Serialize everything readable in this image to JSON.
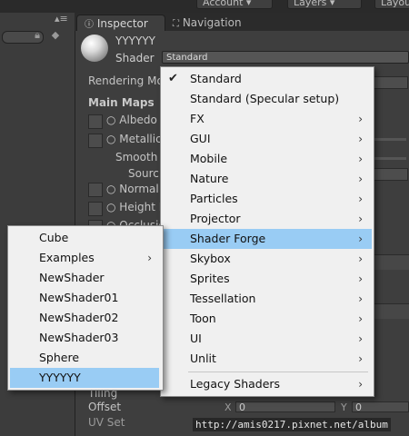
{
  "topbar": {
    "account_label": "Account",
    "layers_label": "Layers",
    "layout_label": "Layou"
  },
  "tabs": [
    {
      "label": "Inspector",
      "icon": "info-icon"
    },
    {
      "label": "Navigation",
      "icon": "navigation-icon"
    }
  ],
  "material": {
    "name": "YYYYYY",
    "shader_label": "Shader",
    "shader_value": "Standard"
  },
  "inspector": {
    "rendering_mode": "Rendering Mo",
    "main_maps": "Main Maps",
    "albedo": "Albedo",
    "metallic": "Metallic",
    "smoothness": "Smooth",
    "source": "Sourc",
    "normal_map": "Normal M",
    "height_map": "Height M",
    "occlusion": "Occlusio",
    "tiling": "Tiling",
    "offset": "Offset",
    "offset_x_label": "X",
    "offset_x_value": "0",
    "offset_y_label": "Y",
    "offset_y_value": "0",
    "uv_set": "UV Set"
  },
  "shader_menu": {
    "items": [
      {
        "label": "Standard",
        "checked": true,
        "submenu": false
      },
      {
        "label": "Standard (Specular setup)",
        "submenu": false
      },
      {
        "label": "FX",
        "submenu": true
      },
      {
        "label": "GUI",
        "submenu": true
      },
      {
        "label": "Mobile",
        "submenu": true
      },
      {
        "label": "Nature",
        "submenu": true
      },
      {
        "label": "Particles",
        "submenu": true
      },
      {
        "label": "Projector",
        "submenu": true
      },
      {
        "label": "Shader Forge",
        "submenu": true,
        "highlighted": true
      },
      {
        "label": "Skybox",
        "submenu": true
      },
      {
        "label": "Sprites",
        "submenu": true
      },
      {
        "label": "Tessellation",
        "submenu": true
      },
      {
        "label": "Toon",
        "submenu": true
      },
      {
        "label": "UI",
        "submenu": true
      },
      {
        "label": "Unlit",
        "submenu": true
      },
      {
        "label": "Legacy Shaders",
        "submenu": true
      }
    ],
    "arrow_glyph": "›",
    "check_glyph": "✔"
  },
  "shader_forge_submenu": {
    "items": [
      {
        "label": "Cube",
        "submenu": false
      },
      {
        "label": "Examples",
        "submenu": true
      },
      {
        "label": "NewShader",
        "submenu": false
      },
      {
        "label": "NewShader01",
        "submenu": false
      },
      {
        "label": "NewShader02",
        "submenu": false
      },
      {
        "label": "NewShader03",
        "submenu": false
      },
      {
        "label": "Sphere",
        "submenu": false
      },
      {
        "label": "YYYYYY",
        "submenu": false,
        "highlighted": true
      }
    ]
  },
  "watermark": "http://amis0217.pixnet.net/album",
  "colors": {
    "highlight": "#99ccf4",
    "menu_bg": "#f0f0f0",
    "editor_bg": "#3e3e3e"
  }
}
